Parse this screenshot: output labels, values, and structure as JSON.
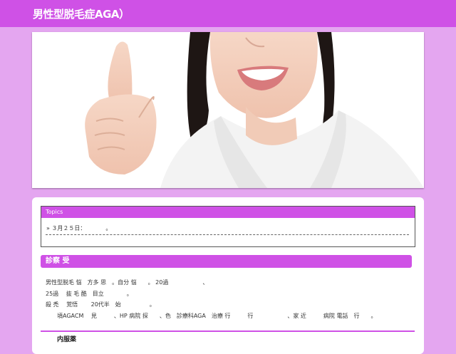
{
  "header": {
    "title": "男性型脱毛症AGA）",
    "bg_color": "#cf51e6"
  },
  "hero": {
    "description_icon": "smiling-woman-raising-finger-photo"
  },
  "topics": {
    "heading": "Topics",
    "items": [
      "» ３月２５日：　　　　。"
    ]
  },
  "section": {
    "heading": "診察 受",
    "paragraphs": [
      "男性型脱毛 悩　方多 思　。自分 悩　　。 20過　　　　　　、",
      "25過　 抜 毛 酷　目立　　　　。",
      "殺 禿　 覚悟　　 20代半　始　　　　　。",
      "　　頃AGACM　 見　　　、HP 病院 探　　、色　診療科AGA　治療 行　　　行　　　　　　、家 近　　　病院 電話　行　　。"
    ],
    "subheading": "内服薬"
  },
  "colors": {
    "accent": "#cf51e6",
    "page_bg": "#e4a6f0"
  }
}
